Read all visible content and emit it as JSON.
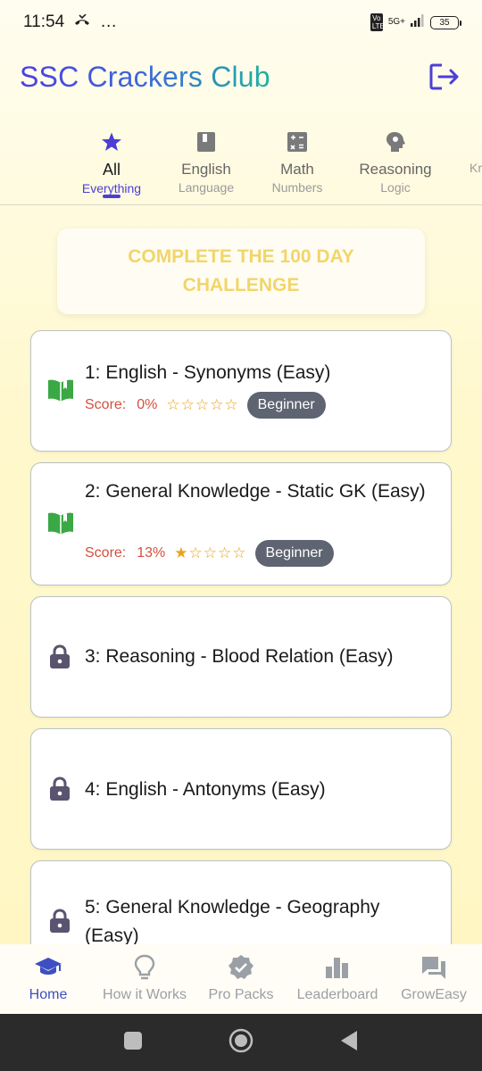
{
  "status_bar": {
    "time": "11:54",
    "extra": "…",
    "volte": "Vo LTE",
    "network": "5G+",
    "battery": "35"
  },
  "header": {
    "title": "SSC Crackers Club"
  },
  "tabs": [
    {
      "label": "All",
      "sub": "Everything",
      "icon": "star-icon",
      "active": true
    },
    {
      "label": "English",
      "sub": "Language",
      "icon": "book-icon",
      "active": false
    },
    {
      "label": "Math",
      "sub": "Numbers",
      "icon": "calculator-icon",
      "active": false
    },
    {
      "label": "Reasoning",
      "sub": "Logic",
      "icon": "brain-icon",
      "active": false
    },
    {
      "label": "",
      "sub": "Kr",
      "icon": "",
      "active": false
    }
  ],
  "challenge": {
    "text": "COMPLETE THE 100 DAY CHALLENGE"
  },
  "quizzes": [
    {
      "title": "1: English - Synonyms (Easy)",
      "locked": false,
      "score_label": "Score:",
      "score": "0%",
      "stars_filled": 0,
      "stars_total": 5,
      "level": "Beginner"
    },
    {
      "title": "2: General Knowledge - Static GK (Easy)",
      "locked": false,
      "score_label": "Score:",
      "score": "13%",
      "stars_filled": 1,
      "stars_total": 5,
      "level": "Beginner"
    },
    {
      "title": "3: Reasoning - Blood Relation (Easy)",
      "locked": true
    },
    {
      "title": "4: English - Antonyms (Easy)",
      "locked": true
    },
    {
      "title": "5: General Knowledge - Geography (Easy)",
      "locked": true
    }
  ],
  "bottom_nav": [
    {
      "label": "Home",
      "icon": "graduation-cap-icon",
      "active": true
    },
    {
      "label": "How it Works",
      "icon": "lightbulb-icon",
      "active": false
    },
    {
      "label": "Pro Packs",
      "icon": "verified-badge-icon",
      "active": false
    },
    {
      "label": "Leaderboard",
      "icon": "bar-chart-icon",
      "active": false
    },
    {
      "label": "GrowEasy",
      "icon": "chat-icon",
      "active": false
    }
  ],
  "colors": {
    "accent": "#4b3fd6",
    "score": "#d4503f",
    "star": "#e8a317",
    "badge": "#5f6472",
    "open_icon": "#3aa845",
    "lock_icon": "#5a5470"
  }
}
